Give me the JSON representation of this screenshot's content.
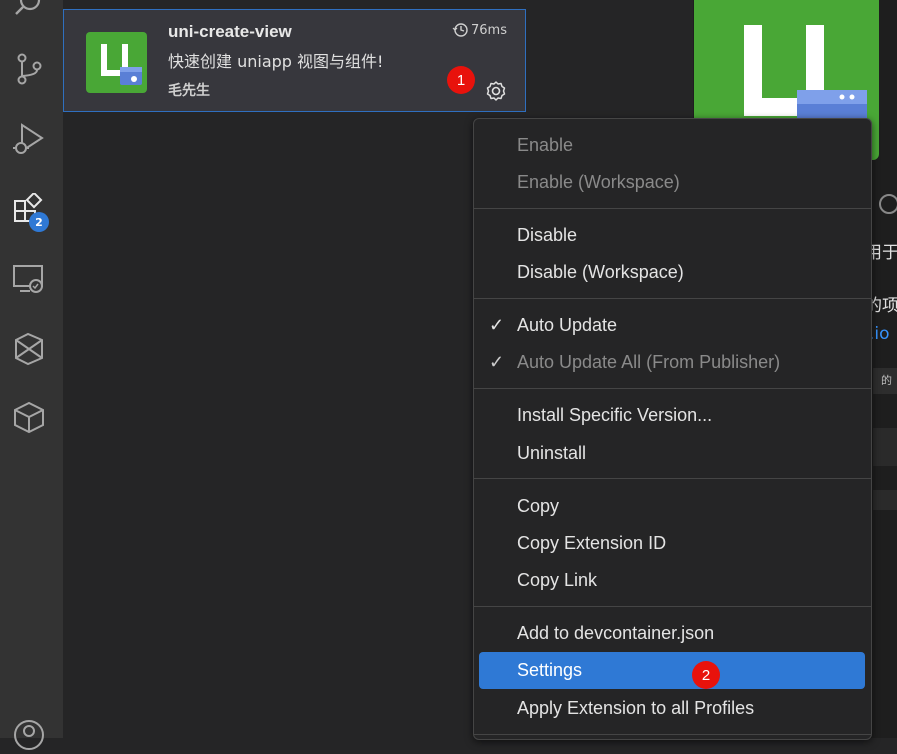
{
  "activity_bar": {
    "icons": [
      "search-icon",
      "source-control-icon",
      "run-debug-icon",
      "extensions-icon",
      "remote-explorer-icon",
      "testing-icon",
      "package-icon",
      "account-icon"
    ],
    "extensions_badge": "2"
  },
  "extension": {
    "name": "uni-create-view",
    "description": "快速创建 uniapp 视图与组件!",
    "author": "毛先生",
    "activation_time": "76ms"
  },
  "markers": {
    "one": "1",
    "two": "2"
  },
  "detail_panel": {
    "fragment_1": "用于",
    "fragment_2": "的项",
    "link_fragment": ".io",
    "fragment_3": "的"
  },
  "menu": {
    "group1": [
      "Enable",
      "Enable (Workspace)"
    ],
    "group2": [
      "Disable",
      "Disable (Workspace)"
    ],
    "group3": [
      "Auto Update",
      "Auto Update All (From Publisher)"
    ],
    "group4": [
      "Install Specific Version...",
      "Uninstall"
    ],
    "group5": [
      "Copy",
      "Copy Extension ID",
      "Copy Link"
    ],
    "group6": [
      "Add to devcontainer.json",
      "Settings",
      "Apply Extension to all Profiles"
    ],
    "check_glyph": "✓"
  },
  "colors": {
    "accent": "#2f79d5",
    "extension_logo": "#49a736",
    "marker": "#e8120c"
  }
}
